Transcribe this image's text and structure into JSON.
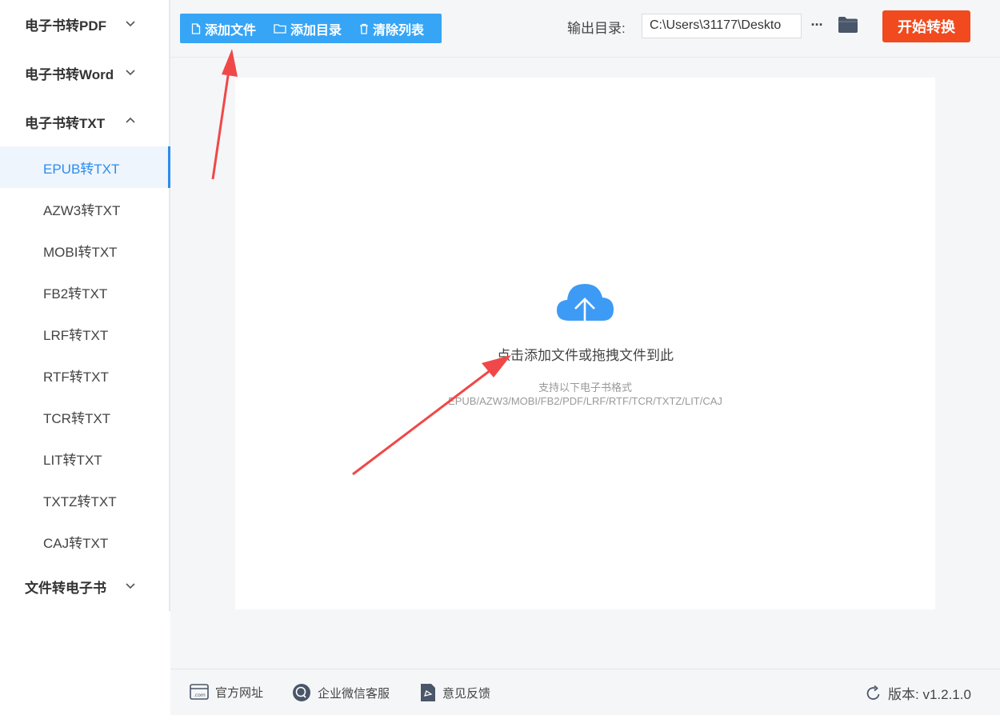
{
  "sidebar": {
    "groups": [
      {
        "label": "电子书转PDF"
      },
      {
        "label": "电子书转Word"
      },
      {
        "label": "电子书转TXT"
      },
      {
        "label": "文件转电子书"
      }
    ],
    "txt_items": [
      {
        "label": "EPUB转TXT"
      },
      {
        "label": "AZW3转TXT"
      },
      {
        "label": "MOBI转TXT"
      },
      {
        "label": "FB2转TXT"
      },
      {
        "label": "LRF转TXT"
      },
      {
        "label": "RTF转TXT"
      },
      {
        "label": "TCR转TXT"
      },
      {
        "label": "LIT转TXT"
      },
      {
        "label": "TXTZ转TXT"
      },
      {
        "label": "CAJ转TXT"
      }
    ]
  },
  "toolbar": {
    "add_file": "添加文件",
    "add_dir": "添加目录",
    "clear_list": "清除列表",
    "output_label": "输出目录:",
    "output_path": "C:\\Users\\31177\\Deskto",
    "more": "···",
    "start": "开始转换"
  },
  "dropzone": {
    "title": "点击添加文件或拖拽文件到此",
    "subtitle": "支持以下电子书格式",
    "formats": "EPUB/AZW3/MOBI/FB2/PDF/LRF/RTF/TCR/TXTZ/LIT/CAJ"
  },
  "footer": {
    "website": "官方网址",
    "wechat": "企业微信客服",
    "feedback": "意见反馈",
    "version": "版本: v1.2.1.0"
  },
  "colors": {
    "accent": "#2c8cf0",
    "toolbar_button": "#36a5f6",
    "start_button": "#f04a1e",
    "arrow": "#f04848"
  }
}
